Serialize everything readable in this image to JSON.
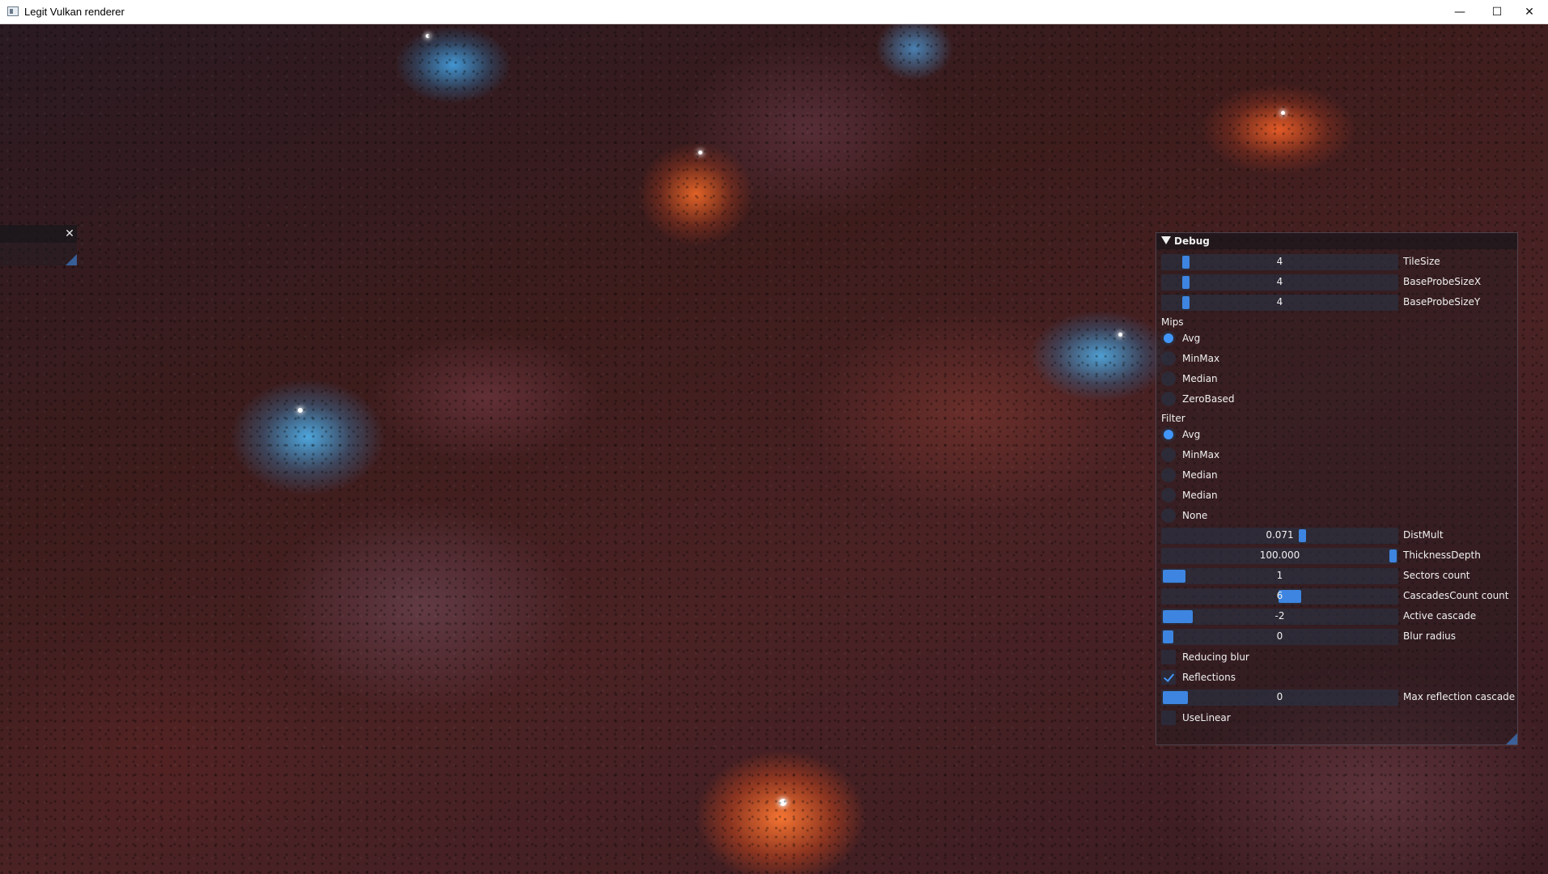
{
  "window": {
    "title": "Legit Vulkan renderer",
    "minimize_glyph": "—",
    "maximize_glyph": "☐",
    "close_glyph": "✕"
  },
  "mini_window": {
    "close_glyph": "✕"
  },
  "debug": {
    "title": "Debug",
    "sliders_top": [
      {
        "label": "TileSize",
        "value": "4"
      },
      {
        "label": "BaseProbeSizeX",
        "value": "4"
      },
      {
        "label": "BaseProbeSizeY",
        "value": "4"
      }
    ],
    "mips": {
      "heading": "Mips",
      "options": [
        "Avg",
        "MinMax",
        "Median",
        "ZeroBased"
      ],
      "selected": "Avg"
    },
    "filter": {
      "heading": "Filter",
      "options": [
        "Avg",
        "MinMax",
        "Median",
        "Median",
        "None"
      ],
      "selected": "Avg"
    },
    "sliders_bottom": [
      {
        "label": "DistMult",
        "value": "0.071"
      },
      {
        "label": "ThicknessDepth",
        "value": "100.000"
      },
      {
        "label": "Sectors count",
        "value": "1"
      },
      {
        "label": "CascadesCount count",
        "value": "6"
      },
      {
        "label": "Active cascade",
        "value": "-2"
      },
      {
        "label": "Blur radius",
        "value": "0"
      }
    ],
    "checkboxes": [
      {
        "label": "Reducing blur",
        "checked": false
      },
      {
        "label": "Reflections",
        "checked": true
      }
    ],
    "max_reflection": {
      "label": "Max reflection cascade",
      "value": "0"
    },
    "use_linear": {
      "label": "UseLinear",
      "checked": false
    }
  },
  "colors": {
    "accent": "#4296fa",
    "slider_grab": "#3d85e0"
  }
}
